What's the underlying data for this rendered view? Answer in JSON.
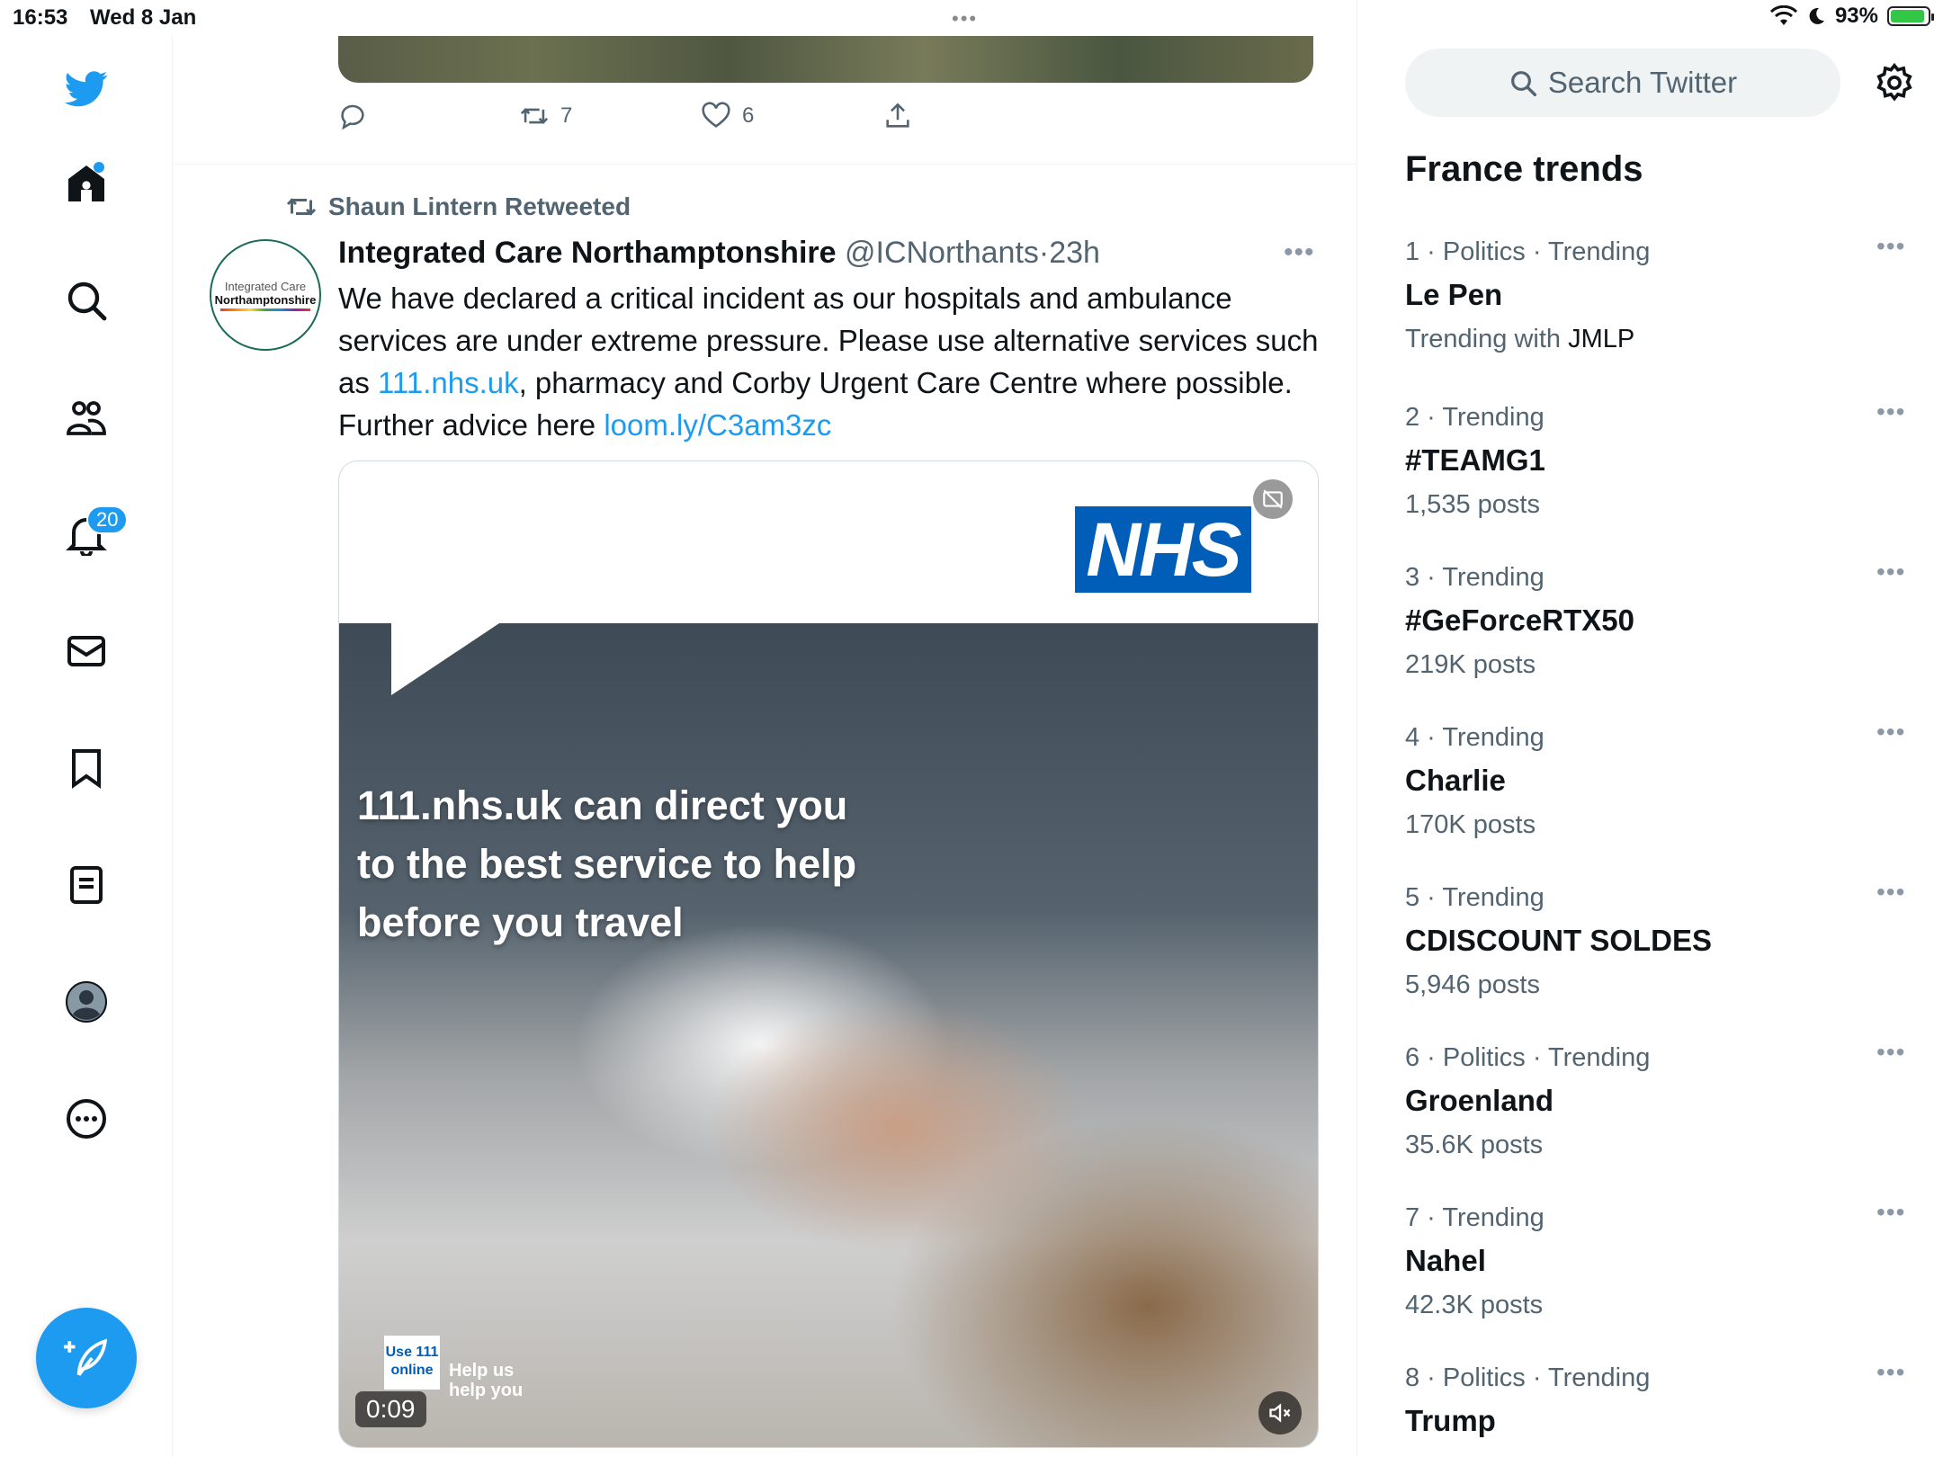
{
  "status_bar": {
    "time": "16:53",
    "date": "Wed 8 Jan",
    "battery": "93%"
  },
  "sidebar": {
    "notifications_badge": "20",
    "items": [
      "twitter-logo",
      "home",
      "explore",
      "communities",
      "notifications",
      "messages",
      "bookmarks",
      "lists",
      "profile",
      "more"
    ]
  },
  "previous_tweet": {
    "retweets": "7",
    "likes": "6"
  },
  "tweet": {
    "retweeted_by": "Shaun Lintern Retweeted",
    "avatar_line1": "Integrated Care",
    "avatar_line2": "Northamptonshire",
    "author_name": "Integrated Care Northamptonshire",
    "handle": "@ICNorthants",
    "separator": "·",
    "time_ago": "23h",
    "text_part1": "We have declared a critical incident as our hospitals and ambulance services are under extreme pressure. Please use alternative services such as ",
    "link1": "111.nhs.uk",
    "text_part2": ", pharmacy and Corby Urgent Care Centre where possible. Further advice here ",
    "link2": "loom.ly/C3am3zc",
    "media": {
      "logo_text": "NHS",
      "overlay_text": "111.nhs.uk can direct you to the best service to help before you travel",
      "use111_line1": "Use 111",
      "use111_line2": "online",
      "help_line1": "Help us",
      "help_line2": "help you",
      "duration": "0:09"
    }
  },
  "search": {
    "placeholder": "Search Twitter"
  },
  "trends": {
    "title": "France trends",
    "items": [
      {
        "meta": "1 · Politics · Trending",
        "name": "Le Pen",
        "sub_prefix": "Trending with ",
        "sub_strong": "JMLP"
      },
      {
        "meta": "2 · Trending",
        "name": "#TEAMG1",
        "sub": "1,535 posts"
      },
      {
        "meta": "3 · Trending",
        "name": "#GeForceRTX50",
        "sub": "219K posts"
      },
      {
        "meta": "4 · Trending",
        "name": "Charlie",
        "sub": "170K posts"
      },
      {
        "meta": "5 · Trending",
        "name": "CDISCOUNT SOLDES",
        "sub": "5,946 posts"
      },
      {
        "meta": "6 · Politics · Trending",
        "name": "Groenland",
        "sub": "35.6K posts"
      },
      {
        "meta": "7 · Trending",
        "name": "Nahel",
        "sub": "42.3K posts"
      },
      {
        "meta": "8 · Politics · Trending",
        "name": "Trump",
        "sub": ""
      }
    ]
  },
  "colors": {
    "accent": "#1d9bf0",
    "nhs_blue": "#005eb8",
    "muted": "#536471"
  }
}
